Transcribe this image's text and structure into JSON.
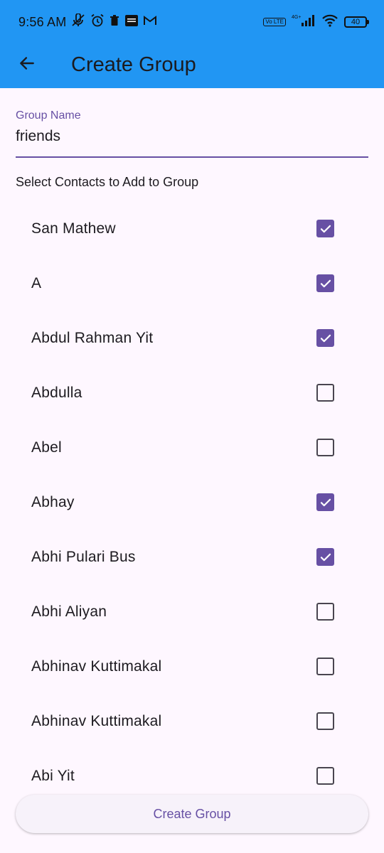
{
  "status_bar": {
    "time": "9:56 AM",
    "left_icons": [
      "muted-mic-icon",
      "alarm-icon",
      "delete-icon",
      "news-app-icon",
      "gmail-icon"
    ],
    "volte_label": "Vo LTE",
    "network_label": "4G+",
    "battery_level": "40"
  },
  "app_bar": {
    "title": "Create Group",
    "back_icon": "arrow-back-icon",
    "color": "#2196F3"
  },
  "group_name_field": {
    "label": "Group Name",
    "value": "friends"
  },
  "section_label": "Select Contacts to Add to Group",
  "contacts": [
    {
      "name": "San Mathew",
      "checked": true
    },
    {
      "name": "A",
      "checked": true
    },
    {
      "name": "Abdul Rahman Yit",
      "checked": true
    },
    {
      "name": "Abdulla",
      "checked": false
    },
    {
      "name": "Abel",
      "checked": false
    },
    {
      "name": "Abhay",
      "checked": true
    },
    {
      "name": "Abhi Pulari Bus",
      "checked": true
    },
    {
      "name": "Abhi Aliyan",
      "checked": false
    },
    {
      "name": "Abhinav Kuttimakal",
      "checked": false
    },
    {
      "name": "Abhinav Kuttimakal",
      "checked": false
    },
    {
      "name": "Abi Yit",
      "checked": false
    }
  ],
  "create_button_label": "Create Group",
  "colors": {
    "accent": "#6750A4",
    "background": "#FEF7FF"
  }
}
